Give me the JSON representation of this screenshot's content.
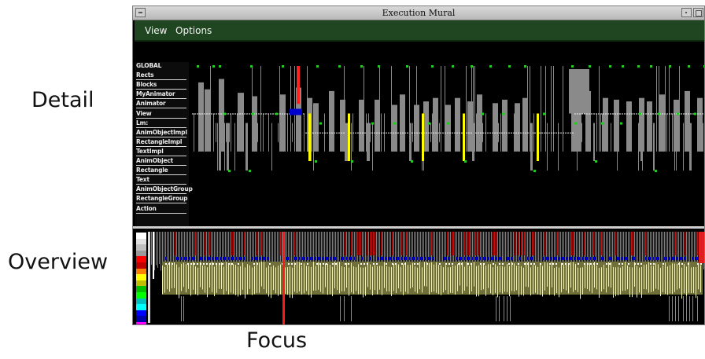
{
  "callouts": {
    "detail": "Detail",
    "overview": "Overview",
    "focus": "Focus"
  },
  "window": {
    "title": "Execution Mural"
  },
  "menu": {
    "view": "View",
    "options": "Options"
  },
  "detail": {
    "labels": [
      "GLOBAL",
      "Rects",
      "Blocks",
      "MyAnimator",
      "Animator",
      "View",
      "Lm:",
      "AnimObjectImpl",
      "RectangleImpl",
      "TextImpl",
      "AnimObject",
      "Rectangle",
      "Text",
      "AnimObjectGroup",
      "RectangleGroup",
      "Action"
    ]
  },
  "colors": {
    "background": "#000000",
    "menubar": "#1f4620",
    "trace": "#8a8a8a",
    "marker": "#22cc22",
    "highlight": "#ffff00",
    "focus": "#ff2020",
    "message": "#0000cc",
    "legend": [
      "#ffffff",
      "#e0e0e0",
      "#bfbfbf",
      "#9a9a9a",
      "#ff0000",
      "#c00000",
      "#ff8000",
      "#ffff00",
      "#c0c000",
      "#00c000",
      "#00ff00",
      "#00c0c0",
      "#00ffff",
      "#0000ff",
      "#0000aa",
      "#ff00ff"
    ]
  }
}
